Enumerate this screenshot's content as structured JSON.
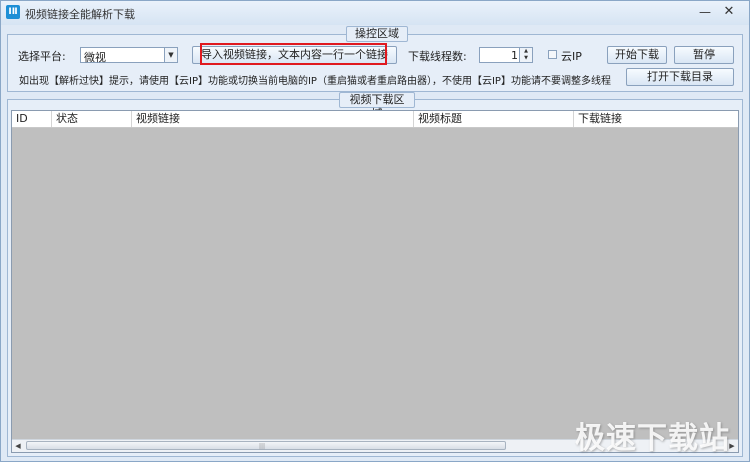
{
  "window": {
    "title": "视频链接全能解析下载",
    "icon_name": "app-icon",
    "minimize_glyph": "—",
    "close_glyph": "✕"
  },
  "control_panel": {
    "legend": "操控区域",
    "platform_label": "选择平台:",
    "platform_value": "微视",
    "import_button": "导入视频链接，文本内容一行一个链接",
    "threads_label": "下载线程数:",
    "threads_value": "1",
    "cloud_ip_label": "云IP",
    "cloud_ip_checked": false,
    "start_button": "开始下载",
    "pause_button": "暂停",
    "open_dir_button": "打开下载目录",
    "hint": "如出现【解析过快】提示，请使用【云IP】功能或切换当前电脑的IP（重启猫或者重启路由器），不使用【云IP】功能请不要调整多线程"
  },
  "download_panel": {
    "legend": "视频下载区域",
    "columns": [
      "ID",
      "状态",
      "视频链接",
      "视频标题",
      "下载链接"
    ],
    "rows": []
  },
  "watermark": "极速下载站",
  "colors": {
    "highlight": "#e0191f",
    "window_bg": "#dfe9f5",
    "list_bg": "#bfbfbf"
  }
}
